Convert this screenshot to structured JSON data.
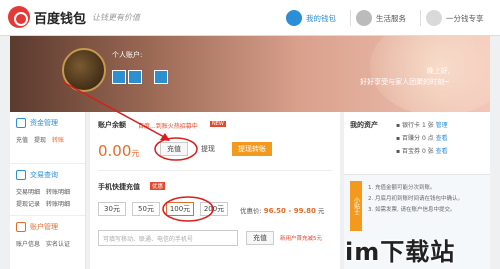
{
  "header": {
    "brand": "百度钱包",
    "slogan": "让钱更有价值",
    "nav": [
      {
        "label": "我的钱包",
        "active": true
      },
      {
        "label": "生活服务",
        "active": false
      },
      {
        "label": "一分钱专享",
        "active": false
      }
    ]
  },
  "banner": {
    "account_label": "个人账户:",
    "greet_line1": "晚上好,",
    "greet_line2": "好好享受与家人团聚的时刻~"
  },
  "sidebar": {
    "groups": [
      {
        "title": "资金管理",
        "color": "#2a8fd6",
        "links": [
          "充值",
          "提现",
          "转账"
        ],
        "highlight": [
          2
        ]
      },
      {
        "title": "交易查询",
        "color": "#2a8fd6",
        "links": [
          "交易明细",
          "转账明细",
          "提现记录",
          "转账明细"
        ],
        "highlight": []
      },
      {
        "title": "账户管理",
        "color": "#e46b2e",
        "links": [
          "账户信息",
          "实名认证"
        ],
        "highlight": []
      }
    ]
  },
  "balance": {
    "title": "账户余额",
    "note": "百度...到账火热招募中",
    "new_tag": "NEW",
    "amount": "0.00",
    "unit": "元",
    "recharge": "充值",
    "withdraw": "提现",
    "transfer": "提现转账"
  },
  "mobile": {
    "title": "手机快捷充值",
    "tag": "优惠",
    "amounts": [
      "30元",
      "50元",
      "100元",
      "200元"
    ],
    "selected_index": 2,
    "price_label": "优惠价:",
    "price_value": "96.50 - 99.80",
    "price_unit": "元",
    "input_placeholder": "可填写移动、联通、电信的手机号",
    "recharge": "充值",
    "promo": "新用户首充减5元"
  },
  "assets": {
    "title": "我的资产",
    "rows": [
      {
        "label": "银行卡",
        "count": "1",
        "unit": "张",
        "action": "管理"
      },
      {
        "label": "百赚分",
        "count": "0",
        "unit": "点",
        "action": "查看"
      },
      {
        "label": "百宝券",
        "count": "0",
        "unit": "张",
        "action": "查看"
      }
    ]
  },
  "tips": {
    "badge": "小贴士",
    "items": [
      "1. 充值金额可能分次到账。",
      "2. 月底月初到账时间请在钱包中确认。",
      "3. 如需发票, 请在账户信息中提交。"
    ]
  },
  "watermark": "im下载站",
  "colors": {
    "accent": "#2a8fd6",
    "orange": "#e46b2e",
    "red_annotation": "#d81e1e"
  }
}
